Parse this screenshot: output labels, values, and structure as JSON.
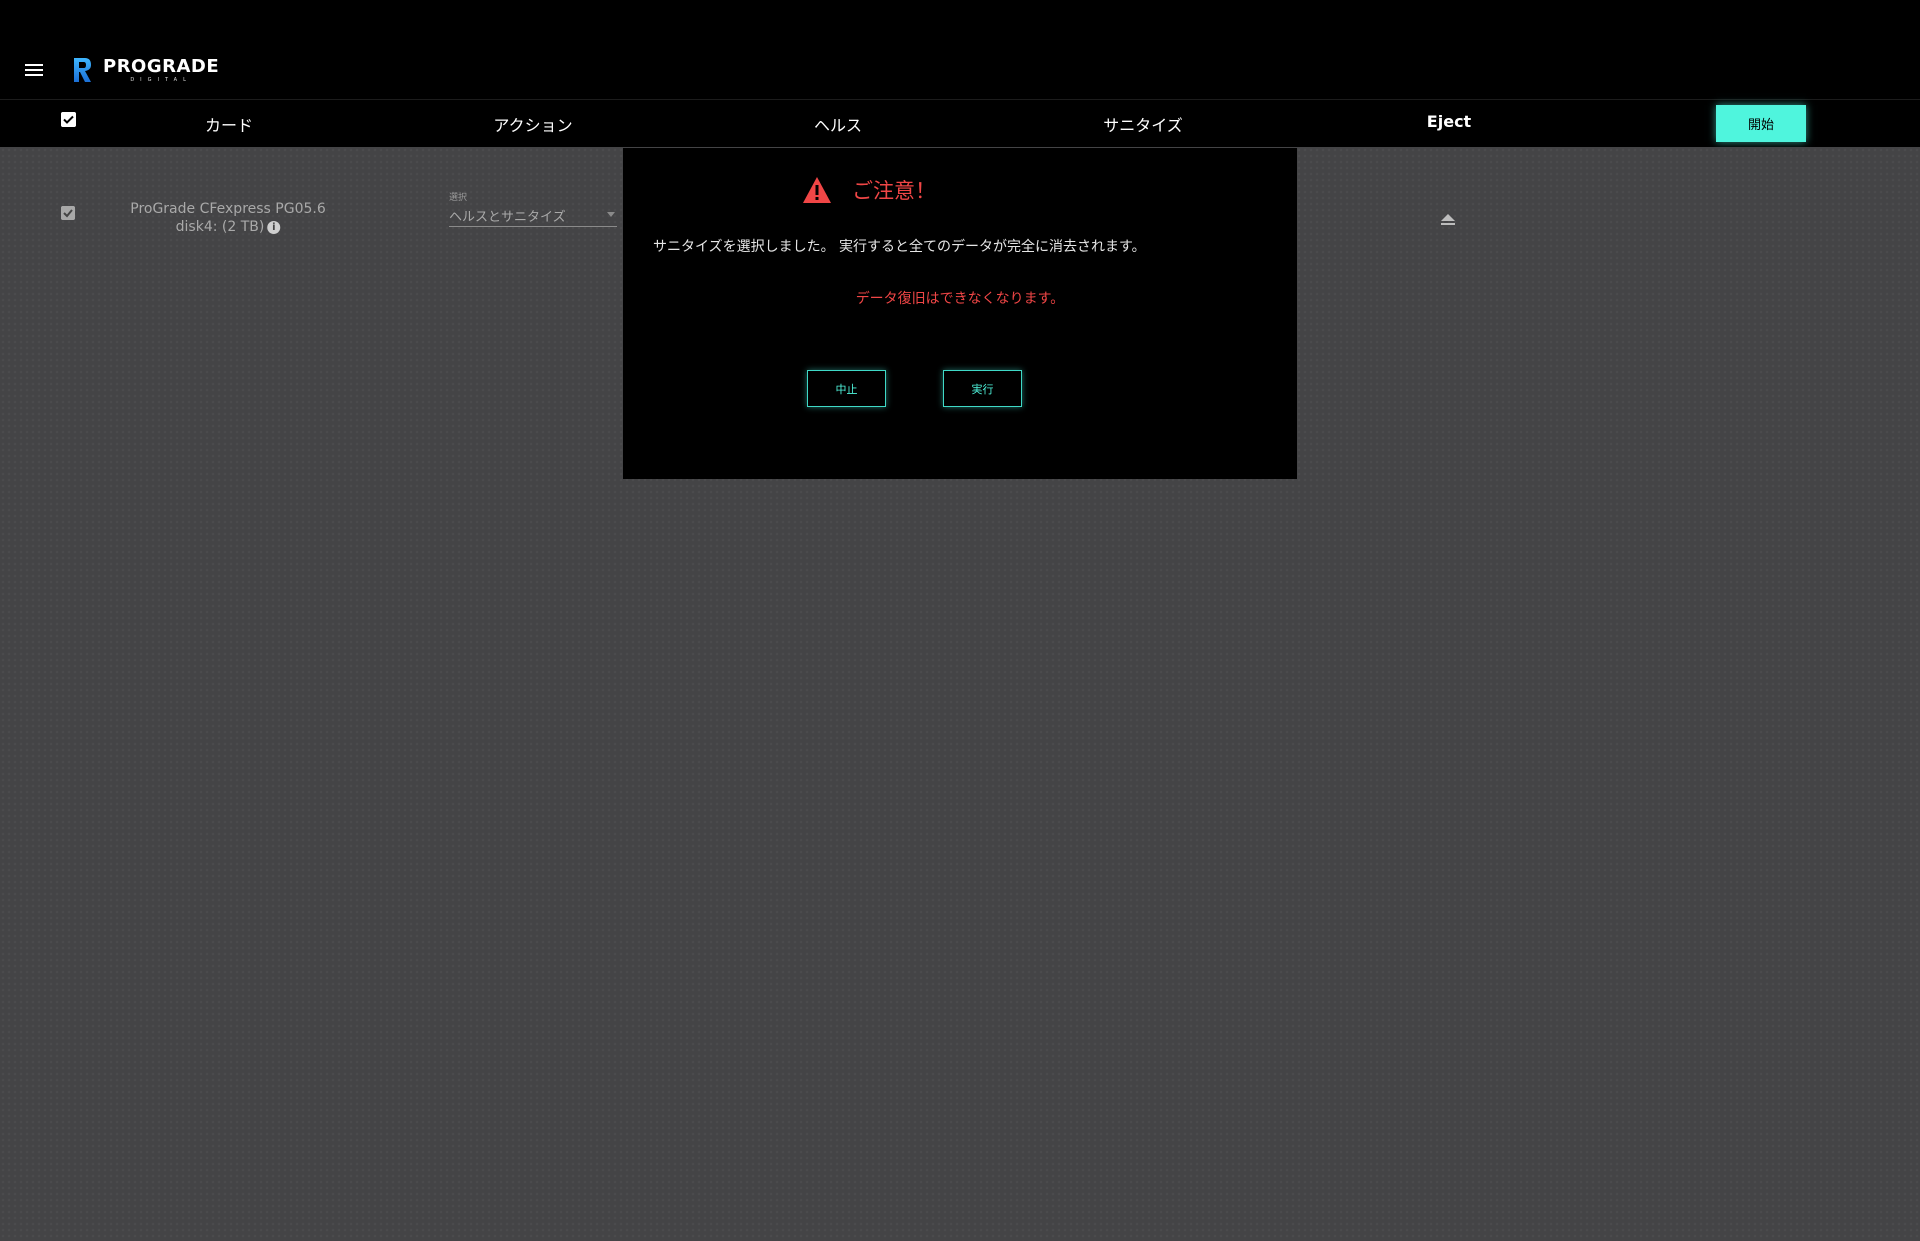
{
  "app": {
    "logo_text": "PROGRADE",
    "logo_subtext": "DIGITAL"
  },
  "header": {
    "col_card": "カード",
    "col_action": "アクション",
    "col_health": "ヘルス",
    "col_sanitize": "サニタイズ",
    "col_eject": "Eject",
    "start_button": "開始"
  },
  "card_row": {
    "name": "ProGrade CFexpress PG05.6",
    "disk": "disk4: (2 TB)",
    "select_label": "選択",
    "select_value": "ヘルスとサニタイズ"
  },
  "dialog": {
    "title": "ご注意！",
    "message": "サニタイズを選択しました。 実行すると全てのデータが完全に消去されます。",
    "warning": "データ復旧はできなくなります。",
    "cancel_button": "中止",
    "execute_button": "実行"
  },
  "colors": {
    "accent": "#4ff5dd",
    "danger": "#f04646",
    "background": "#444446"
  },
  "icons": {
    "menu": "hamburger-icon",
    "checkbox": "checkbox-checked-icon",
    "info": "info-icon",
    "eject": "eject-icon",
    "warning": "warning-triangle-icon"
  }
}
